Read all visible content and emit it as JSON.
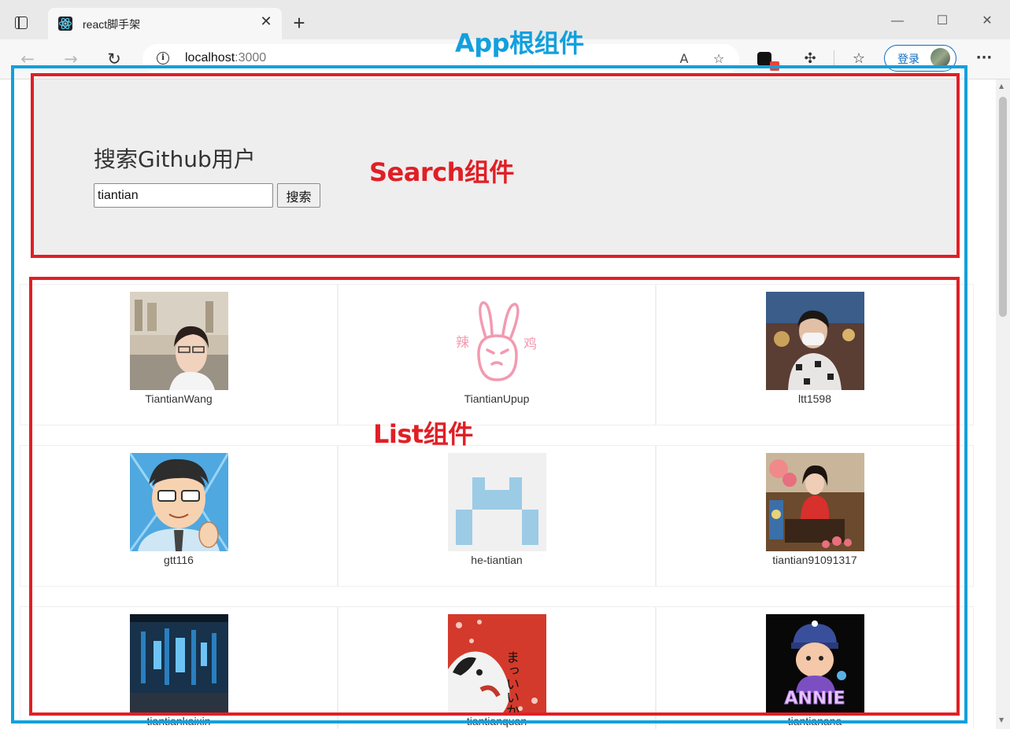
{
  "browser": {
    "tab_title": "react脚手架",
    "tab_close": "✕",
    "new_tab": "+",
    "window_controls": {
      "minimize": "—",
      "maximize": "☐",
      "close": "✕"
    },
    "url_host": "localhost",
    "url_port": ":3000",
    "login_label": "登录",
    "icons": {
      "sidebar": "sidebar-icon",
      "back": "←",
      "forward": "→",
      "refresh": "↻",
      "info": "i",
      "read_aloud": "A",
      "favorite_add": "☆",
      "extensions": "✣",
      "favorites": "☆",
      "more": "···"
    }
  },
  "search": {
    "title": "搜索Github用户",
    "input_value": "tiantian",
    "button_label": "搜索"
  },
  "users": [
    {
      "login": "TiantianWang",
      "avatar": "photo-woman-glasses"
    },
    {
      "login": "TiantianUpup",
      "avatar": "pink-rabbit-drawing",
      "avatar_text_left": "辣",
      "avatar_text_right": "鸡"
    },
    {
      "login": "ltt1598",
      "avatar": "photo-person-mask"
    },
    {
      "login": "gtt116",
      "avatar": "cartoon-man-glasses-thumbsup"
    },
    {
      "login": "he-tiantian",
      "avatar": "identicon-blue"
    },
    {
      "login": "tiantian91091317",
      "avatar": "photo-woman-red-dress"
    },
    {
      "login": "tiantiankaixin",
      "avatar": "photo-server-room"
    },
    {
      "login": "tiantianquan",
      "avatar": "cat-illustration-red",
      "avatar_text": "まっいいか"
    },
    {
      "login": "tiantianana",
      "avatar": "cartoon-annie",
      "avatar_text": "ANNIE"
    }
  ],
  "annotations": {
    "app": "App根组件",
    "search": "Search组件",
    "list": "List组件",
    "colors": {
      "app": "#12a0de",
      "component": "#e01f26"
    }
  }
}
